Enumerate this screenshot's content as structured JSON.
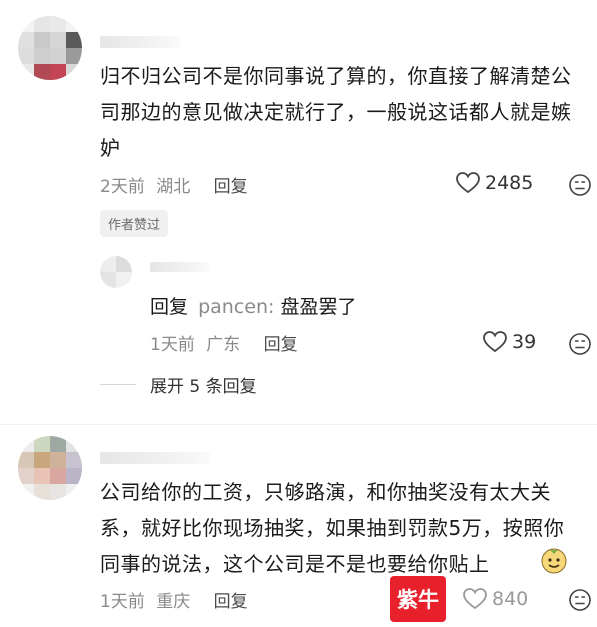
{
  "comments": [
    {
      "text": "归不归公司不是你同事说了算的，你直接了解清楚公司那边的意见做决定就行了，一般说这话都人就是嫉妒",
      "time": "2天前",
      "location": "湖北",
      "reply_label": "回复",
      "likes": "2485",
      "author_badge": "作者赞过",
      "sub_reply": {
        "reply_prefix": "回复",
        "reply_to": "pancen:",
        "text": "盘盈罢了",
        "time": "1天前",
        "location": "广东",
        "reply_label": "回复",
        "likes": "39"
      },
      "expand_label": "展开 5 条回复"
    },
    {
      "text": "公司给你的工资，只够路演，和你抽奖没有太大关系，就好比你现场抽奖，如果抽到罚款5万，按照你同事的说法，这个公司是不是也要给你贴上",
      "time": "1天前",
      "location": "重庆",
      "reply_label": "回复",
      "likes": "840",
      "watermark": "紫牛"
    }
  ],
  "colors": {
    "watermark_bg": "#e8202c",
    "text": "#1b1b1b",
    "meta": "#8a8a8a"
  },
  "icons": [
    "heart-icon",
    "dislike-face-icon",
    "emoji-icon",
    "avatar"
  ]
}
